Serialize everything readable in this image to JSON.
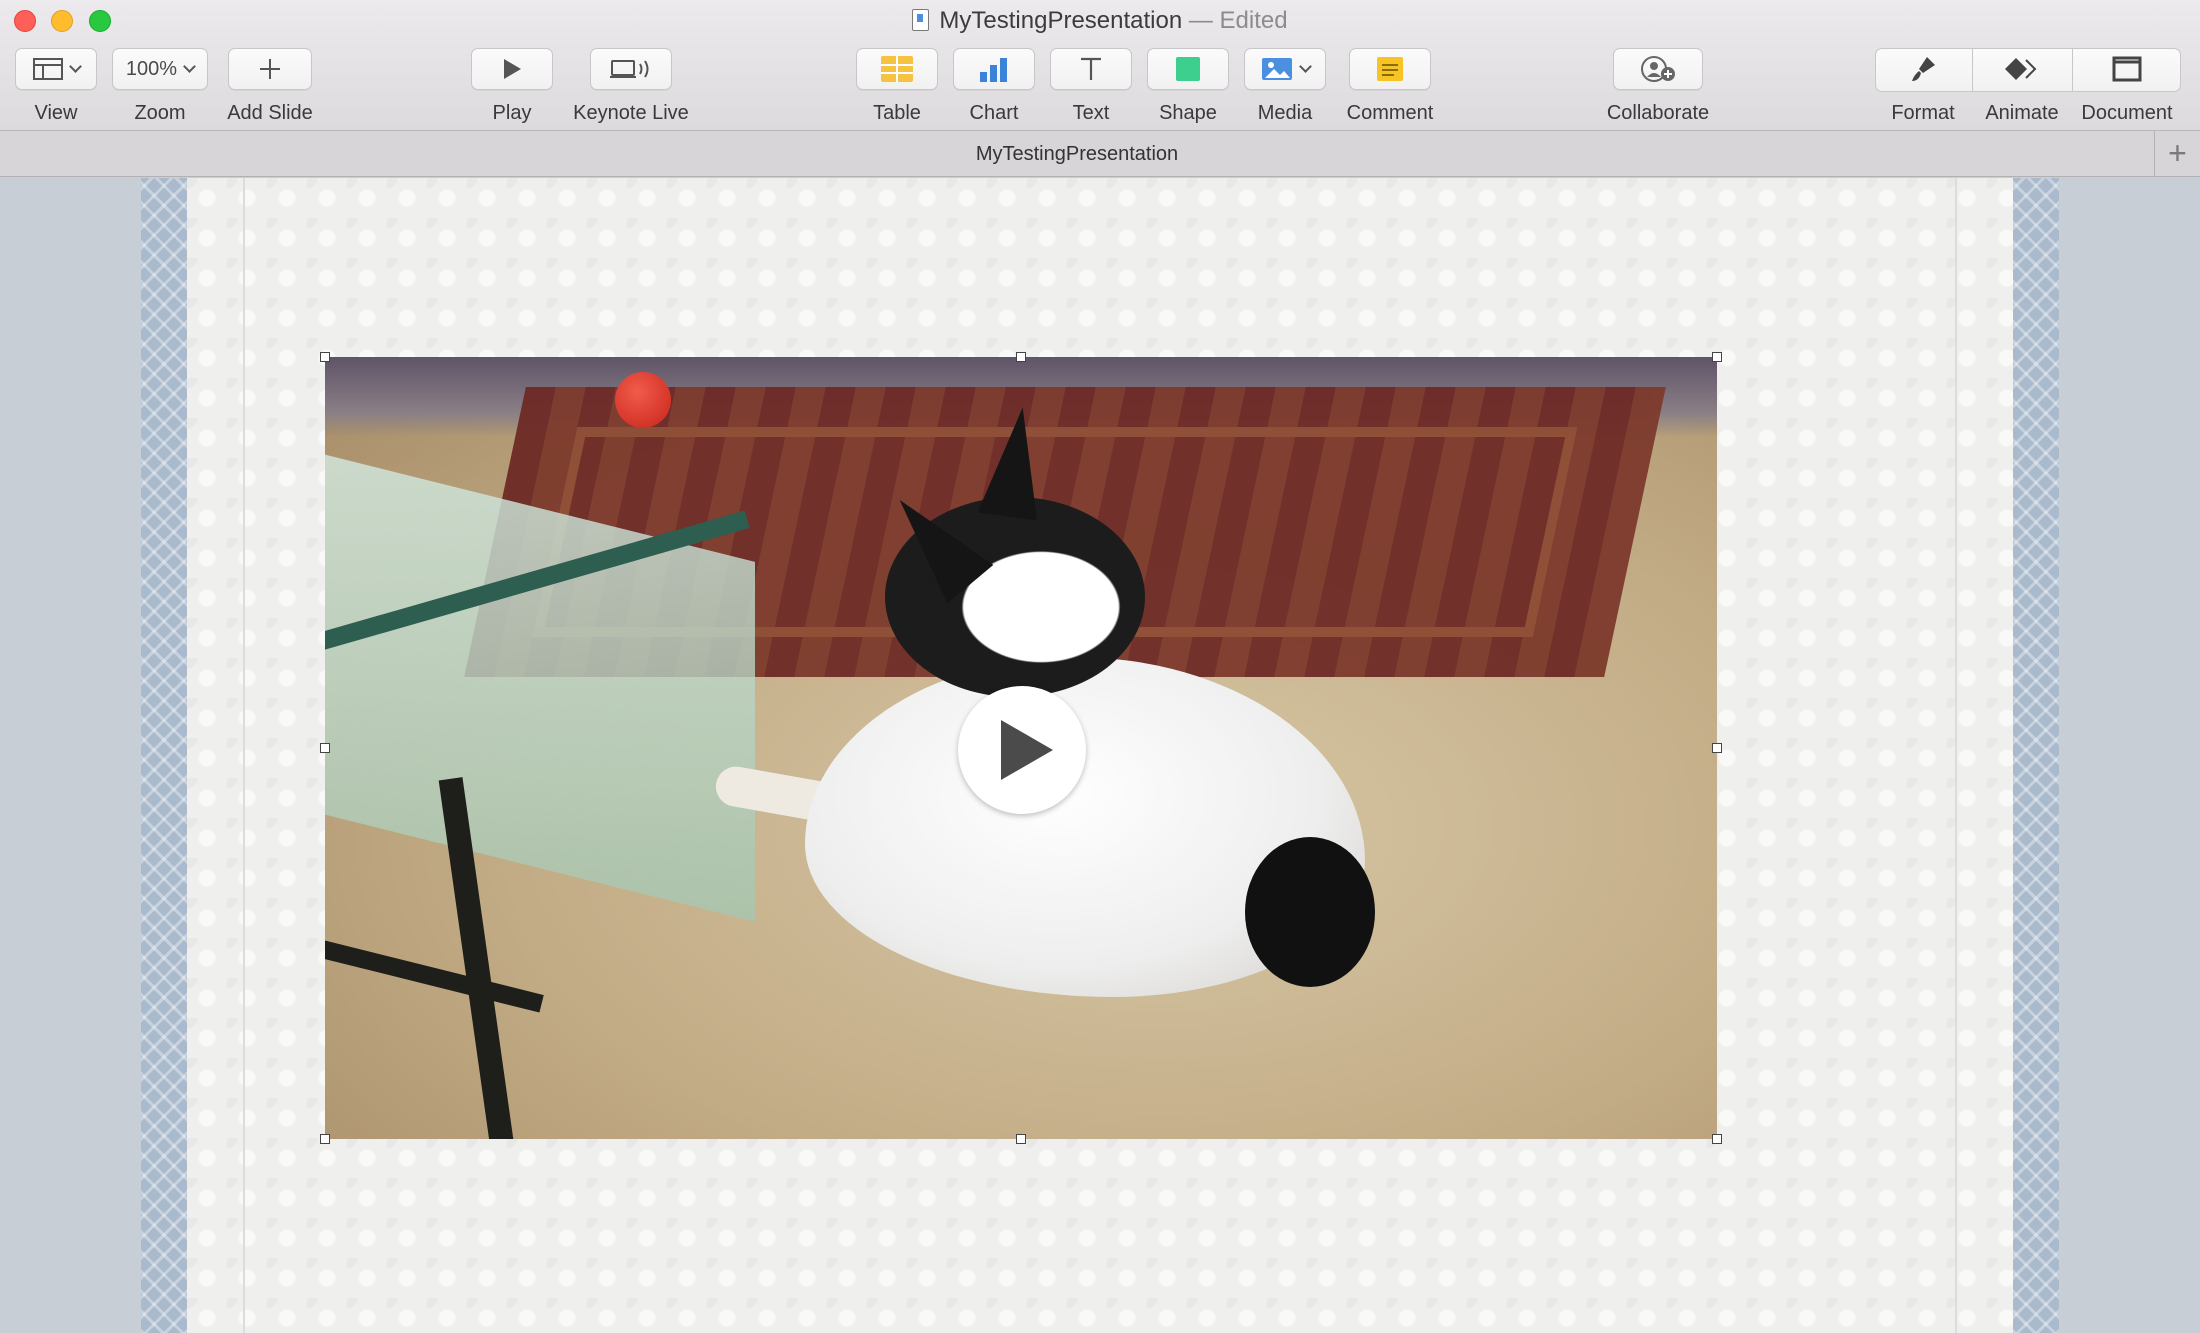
{
  "window": {
    "title": "MyTestingPresentation",
    "status": "— Edited"
  },
  "toolbar": {
    "view": {
      "label": "View",
      "icon": "sidebar-layout-icon"
    },
    "zoom": {
      "label": "Zoom",
      "value": "100%"
    },
    "add_slide": {
      "label": "Add Slide",
      "icon": "plus-icon"
    },
    "play": {
      "label": "Play",
      "icon": "play-icon"
    },
    "keynote_live": {
      "label": "Keynote Live",
      "icon": "keynote-live-icon"
    },
    "table": {
      "label": "Table",
      "icon": "table-icon"
    },
    "chart": {
      "label": "Chart",
      "icon": "bar-chart-icon"
    },
    "text": {
      "label": "Text",
      "icon": "text-icon"
    },
    "shape": {
      "label": "Shape",
      "icon": "square-shape-icon"
    },
    "media": {
      "label": "Media",
      "icon": "photo-icon"
    },
    "comment": {
      "label": "Comment",
      "icon": "comment-note-icon"
    },
    "collaborate": {
      "label": "Collaborate",
      "icon": "add-person-icon"
    },
    "format": {
      "label": "Format",
      "icon": "paintbrush-icon"
    },
    "animate": {
      "label": "Animate",
      "icon": "diamond-animate-icon"
    },
    "document": {
      "label": "Document",
      "icon": "document-rect-icon"
    }
  },
  "tabbar": {
    "title": "MyTestingPresentation",
    "new_tab_symbol": "+"
  },
  "colors": {
    "table_icon": "#f5c242",
    "chart_icon": "#3a83d8",
    "shape_icon": "#3ccf8e",
    "media_icon": "#4a8fe0",
    "comment_icon": "#f7c325",
    "slide_border": "#a9bacd"
  }
}
